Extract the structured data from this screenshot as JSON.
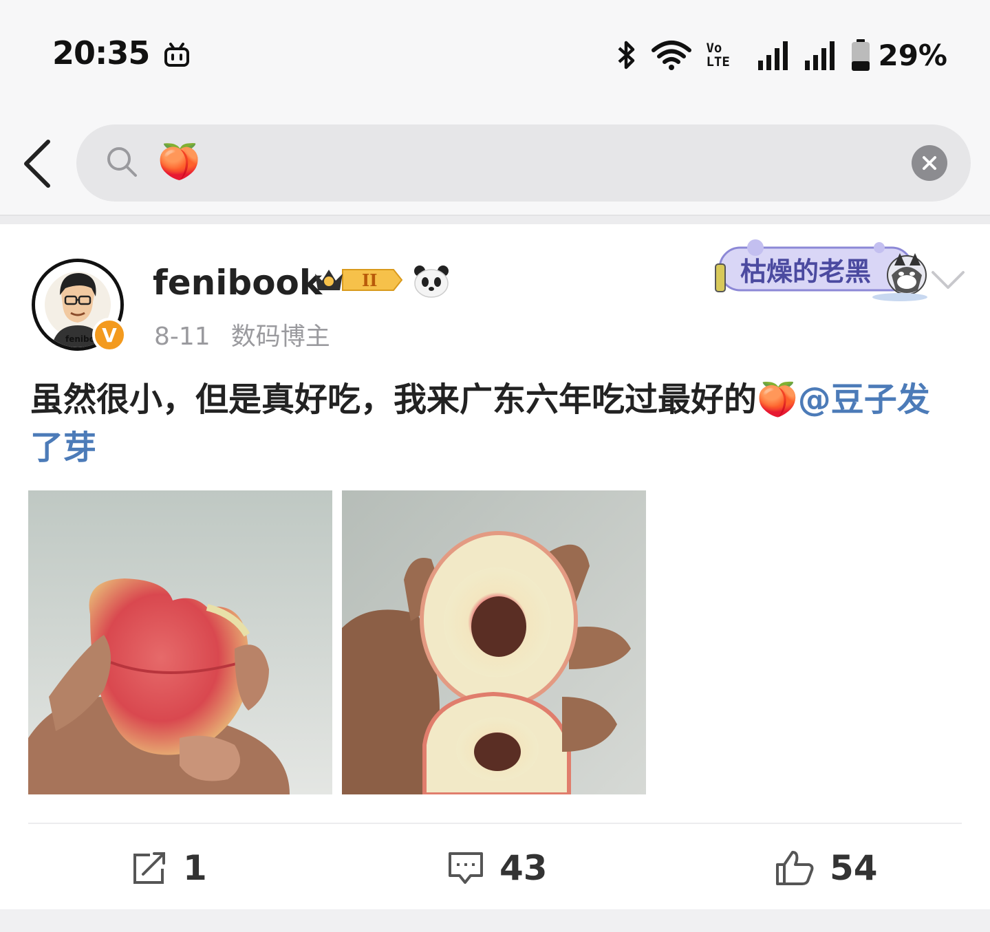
{
  "status_bar": {
    "time": "20:35",
    "network_label": "Vo LTE",
    "battery": "29%"
  },
  "search": {
    "query": "🍑"
  },
  "post": {
    "username": "fenibook",
    "level_badge": "II",
    "date": "8-11",
    "role": "数码博主",
    "sticker_text": "枯燥的老黑",
    "avatar_text": "fenibook",
    "verified_badge": "V",
    "text_main": "虽然很小，但是真好吃，我来广东六年吃过最好的🍑",
    "mention": "@豆子发了芽",
    "repost_count": "1",
    "comment_count": "43",
    "like_count": "54"
  }
}
